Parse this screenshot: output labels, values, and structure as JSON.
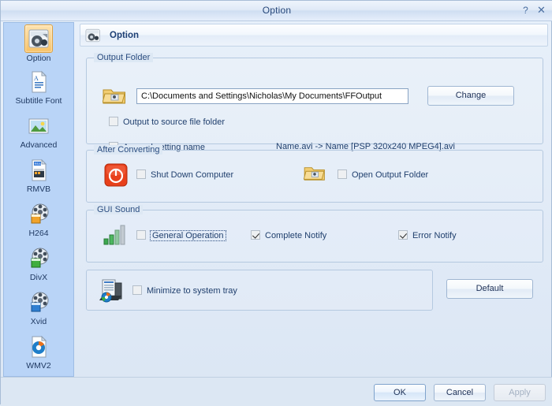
{
  "window": {
    "title": "Option",
    "help_button": "?",
    "close_button": "✕"
  },
  "sidebar": {
    "items": [
      {
        "label": "Option",
        "icon": "option-icon",
        "selected": true
      },
      {
        "label": "Subtitle Font",
        "icon": "subtitle-font-icon",
        "selected": false
      },
      {
        "label": "Advanced",
        "icon": "advanced-icon",
        "selected": false
      },
      {
        "label": "RMVB",
        "icon": "rmvb-icon",
        "selected": false
      },
      {
        "label": "H264",
        "icon": "h264-icon",
        "selected": false
      },
      {
        "label": "DivX",
        "icon": "divx-icon",
        "selected": false
      },
      {
        "label": "Xvid",
        "icon": "xvid-icon",
        "selected": false
      },
      {
        "label": "WMV2",
        "icon": "wmv2-icon",
        "selected": false
      }
    ]
  },
  "page_header": {
    "title": "Option",
    "icon": "option-icon"
  },
  "output_folder": {
    "legend": "Output Folder",
    "folder_icon": "folder-open-icon",
    "path_value": "C:\\Documents and Settings\\Nicholas\\My Documents\\FFOutput",
    "path_placeholder": "",
    "change_button": "Change",
    "output_to_source": {
      "label": "Output to source file folder",
      "checked": false
    },
    "append_setting_name": {
      "label": "Append setting name",
      "checked": false
    },
    "append_hint": "Name.avi  -> Name [PSP 320x240 MPEG4].avi"
  },
  "after_converting": {
    "legend": "After Converting",
    "power_icon": "power-off-icon",
    "shut_down": {
      "label": "Shut Down Computer",
      "checked": false
    },
    "folder_icon": "folder-open-icon",
    "open_output": {
      "label": "Open Output Folder",
      "checked": false
    }
  },
  "gui_sound": {
    "legend": "GUI Sound",
    "sound_icon": "signal-bars-icon",
    "general_operation": {
      "label": "General Operation",
      "checked": false,
      "focused": true
    },
    "complete_notify": {
      "label": "Complete Notify",
      "checked": true
    },
    "error_notify": {
      "label": "Error Notify",
      "checked": true
    }
  },
  "system_tray": {
    "tray_icon": "computer-tray-icon",
    "minimize": {
      "label": "Minimize to system tray",
      "checked": false
    },
    "default_button": "Default"
  },
  "footer": {
    "ok_button": "OK",
    "cancel_button": "Cancel",
    "apply_button": "Apply",
    "apply_disabled": true
  },
  "colors": {
    "titlebar": "#e0eaf7",
    "sidebar_bg": "#b9d4f7",
    "body_bg": "#dce7f3",
    "accent_selected": "#f7c164",
    "text": "#213a5e",
    "power_red": "#e23a1a",
    "signal_green": "#35a84a"
  }
}
